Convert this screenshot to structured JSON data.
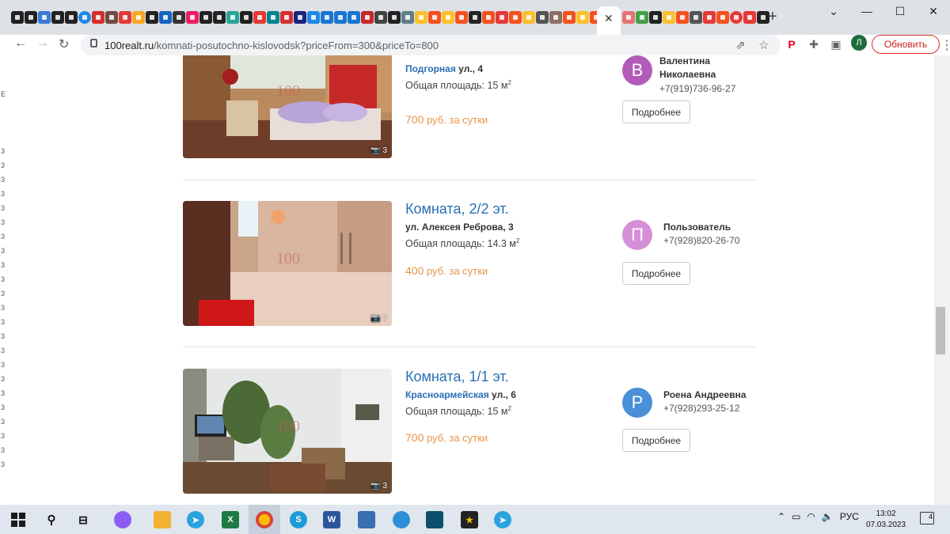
{
  "browser": {
    "url_host": "100realt.ru",
    "url_path": "/komnati-posutochno-kislovodsk?priceFrom=300&priceTo=800",
    "update_button": "Обновить",
    "profile_initial": "Л"
  },
  "listings": [
    {
      "title": "",
      "street": "Подгорная",
      "address_rest": " ул., 4",
      "area_label": "Общая площадь: 15 м",
      "area_sup": "2",
      "price": "700",
      "price_unit": " руб. за сутки",
      "photo_count": "3",
      "agent_initial": "В",
      "agent_color": "#b35bb8",
      "agent_name": "Валентина Николаевна",
      "agent_phone": "+7(919)736-96-27",
      "more_label": "Подробнее"
    },
    {
      "title": "Комната, 2/2 эт.",
      "street": "",
      "address_rest": "ул. Алексея Реброва, 3",
      "area_label": "Общая площадь: 14.3 м",
      "area_sup": "2",
      "price": "400",
      "price_unit": " руб. за сутки",
      "photo_count": "2",
      "agent_initial": "П",
      "agent_color": "#d58fd8",
      "agent_name": "Пользователь",
      "agent_phone": "+7(928)820-26-70",
      "more_label": "Подробнее"
    },
    {
      "title": "Комната, 1/1 эт.",
      "street": "Красноармейская",
      "address_rest": " ул., 6",
      "area_label": "Общая площадь: 15 м",
      "area_sup": "2",
      "price": "700",
      "price_unit": " руб. за сутки",
      "photo_count": "3",
      "agent_initial": "Р",
      "agent_color": "#4a8fd8",
      "agent_name": "Роена Андреевна",
      "agent_phone": "+7(928)293-25-12",
      "more_label": "Подробнее"
    }
  ],
  "watermark": "100",
  "taskbar": {
    "language": "РУС",
    "time": "13:02",
    "date": "07.03.2023",
    "notifications": "4"
  }
}
